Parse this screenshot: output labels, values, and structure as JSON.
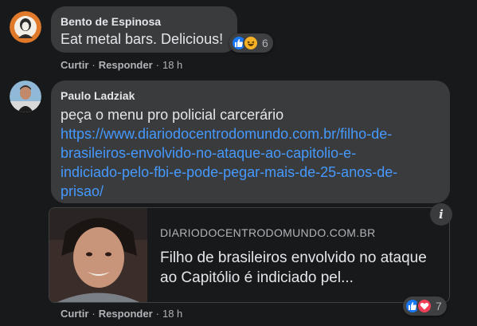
{
  "comments": [
    {
      "author": "Bento de Espinosa",
      "text": "Eat metal bars. Delicious!",
      "reactions": {
        "icons": [
          "like-icon",
          "haha-icon"
        ],
        "count": "6"
      },
      "actions": {
        "like": "Curtir",
        "dot": "·",
        "reply": "Responder",
        "time": "18 h"
      }
    },
    {
      "author": "Paulo Ladziak",
      "text": "peça o menu pro policial carcerário",
      "link_lines": [
        "https://www.diariodocentrodomundo.com.br/filho-de-",
        "brasileiros-envolvido-no-ataque-ao-capitolio-e-",
        "indiciado-pelo-fbi-e-pode-pegar-mais-de-25-anos-de-",
        "prisao/"
      ],
      "preview": {
        "domain": "DIARIODOCENTRODOMUNDO.COM.BR",
        "title": "Filho de brasileiros envolvido no ataque ao Capitólio é indiciado pel...",
        "info_icon": "i"
      },
      "reactions": {
        "icons": [
          "like-icon",
          "love-icon"
        ],
        "count": "7"
      },
      "actions": {
        "like": "Curtir",
        "dot": "·",
        "reply": "Responder",
        "time": "18 h"
      }
    }
  ],
  "colors": {
    "background": "#18191a",
    "bubble": "#3a3b3c",
    "link": "#4599ff",
    "like": "#1877f2",
    "love": "#f33e58",
    "haha": "#f7b125"
  }
}
